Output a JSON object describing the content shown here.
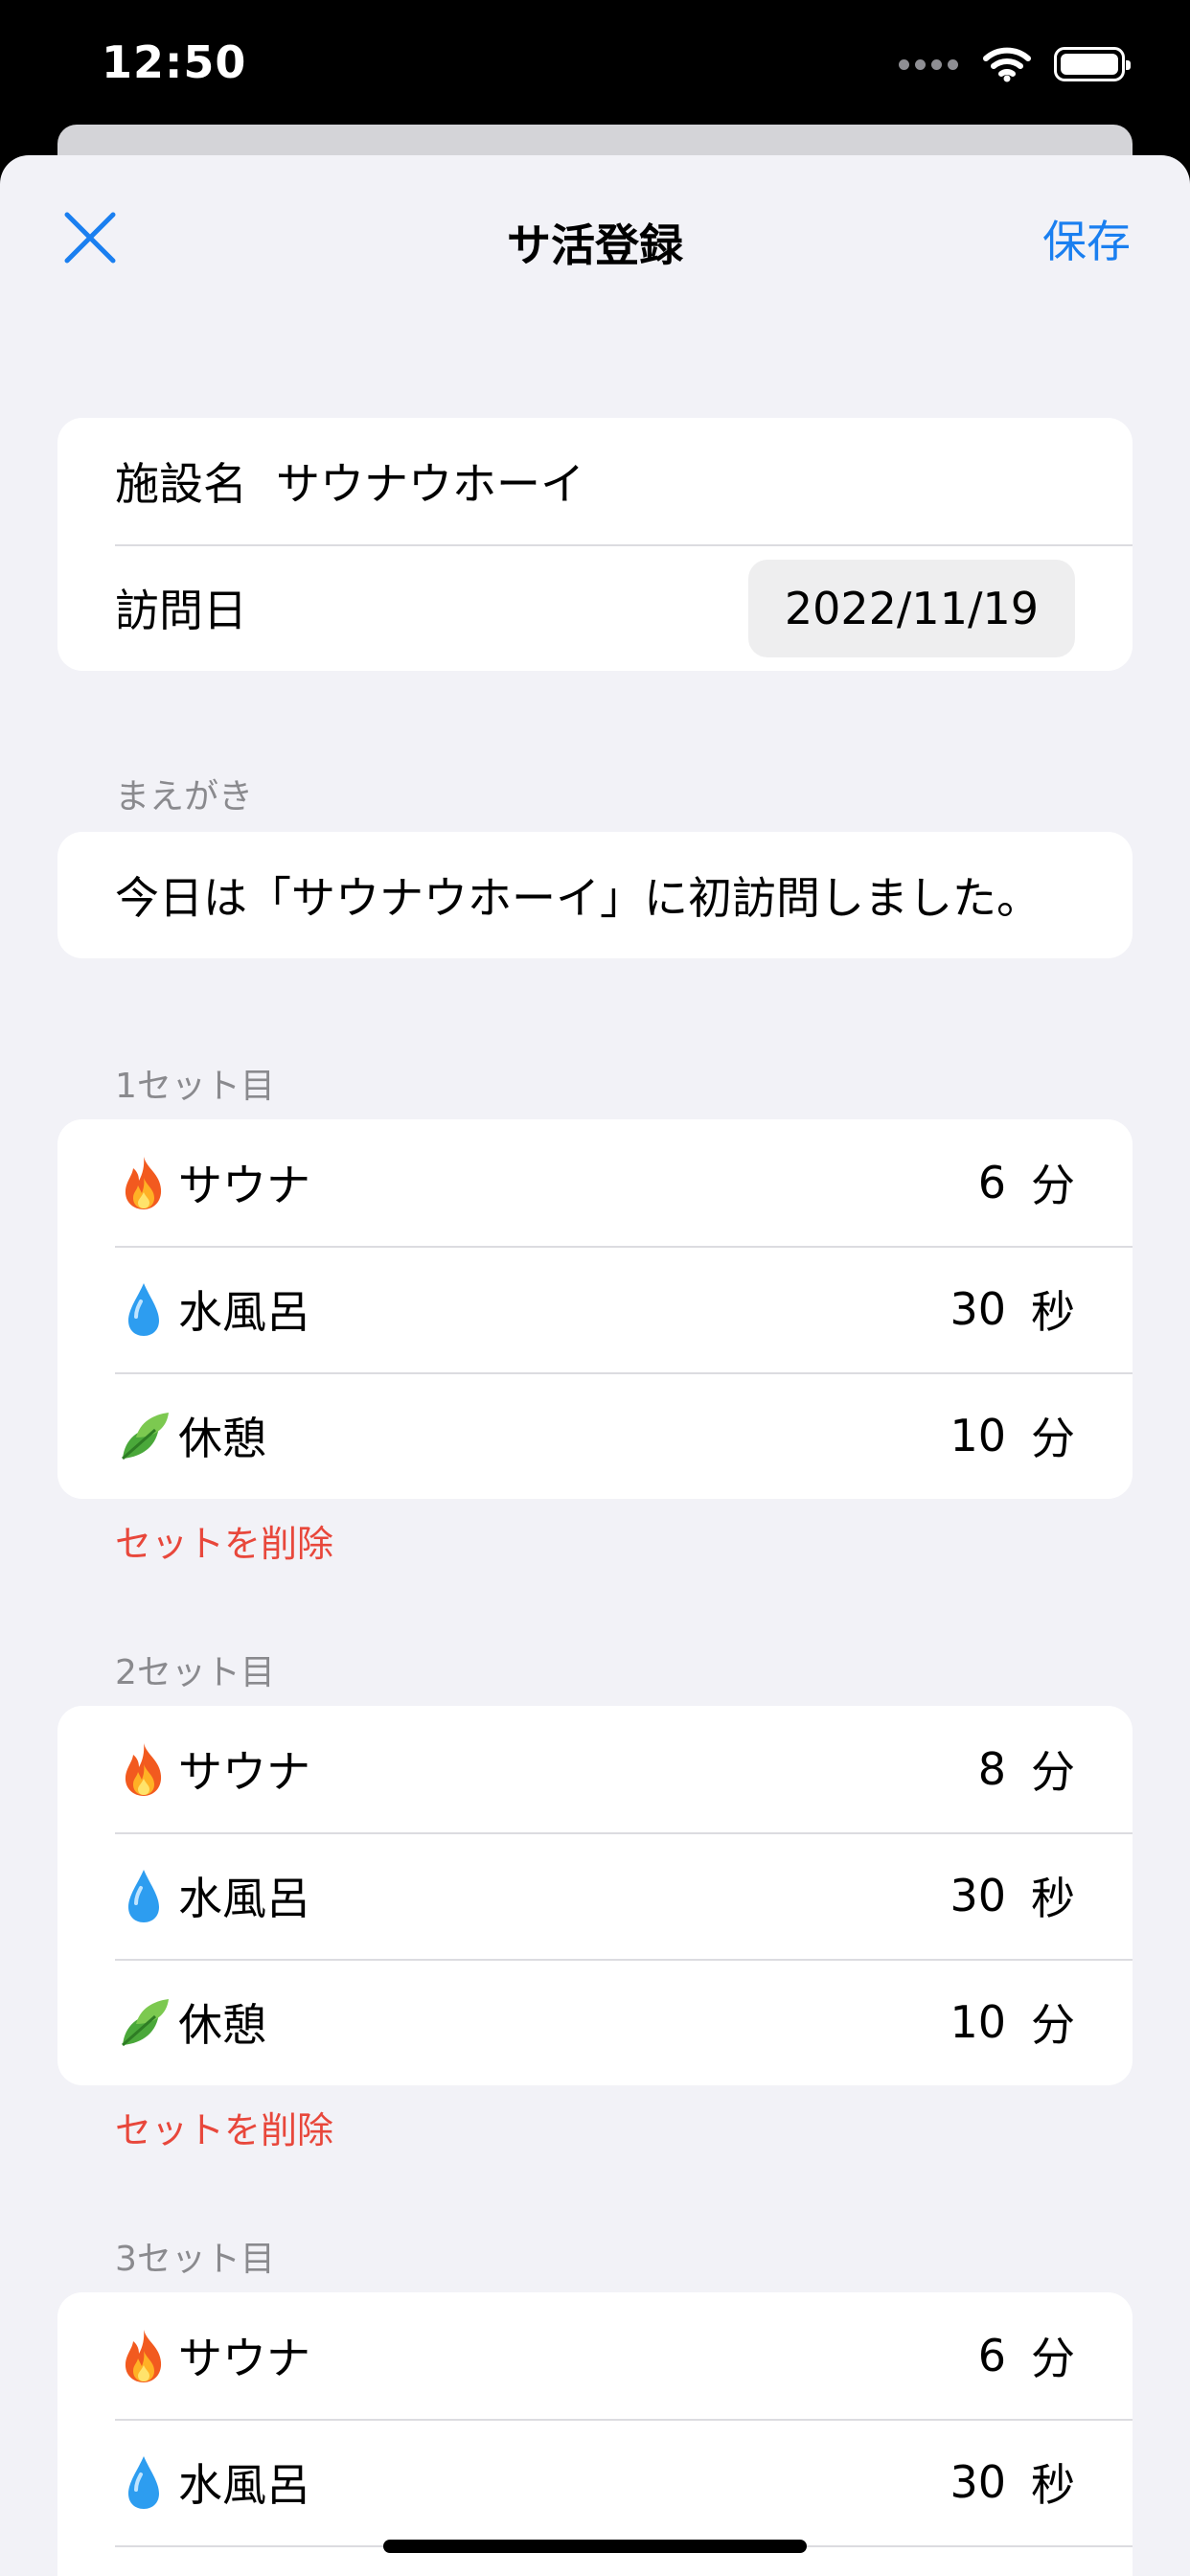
{
  "status": {
    "time": "12:50"
  },
  "nav": {
    "title": "サ活登録",
    "save": "保存"
  },
  "info": {
    "facility_label": "施設名",
    "facility_value": "サウナウホーイ",
    "date_label": "訪問日",
    "date_value": "2022/11/19"
  },
  "preface": {
    "header": "まえがき",
    "text": "今日は「サウナウホーイ」に初訪問しました。"
  },
  "sets": [
    {
      "header": "1セット目",
      "delete": "セットを削除",
      "rows": [
        {
          "icon": "fire-icon",
          "label": "サウナ",
          "value": "6",
          "unit": "分"
        },
        {
          "icon": "droplet-icon",
          "label": "水風呂",
          "value": "30",
          "unit": "秒"
        },
        {
          "icon": "leaf-icon",
          "label": "休憩",
          "value": "10",
          "unit": "分"
        }
      ]
    },
    {
      "header": "2セット目",
      "delete": "セットを削除",
      "rows": [
        {
          "icon": "fire-icon",
          "label": "サウナ",
          "value": "8",
          "unit": "分"
        },
        {
          "icon": "droplet-icon",
          "label": "水風呂",
          "value": "30",
          "unit": "秒"
        },
        {
          "icon": "leaf-icon",
          "label": "休憩",
          "value": "10",
          "unit": "分"
        }
      ]
    },
    {
      "header": "3セット目",
      "rows": [
        {
          "icon": "fire-icon",
          "label": "サウナ",
          "value": "6",
          "unit": "分"
        },
        {
          "icon": "droplet-icon",
          "label": "水風呂",
          "value": "30",
          "unit": "秒"
        }
      ]
    }
  ],
  "colors": {
    "accent": "#1a7ff0",
    "destructive": "#e8473b",
    "background": "#f2f2f7"
  }
}
